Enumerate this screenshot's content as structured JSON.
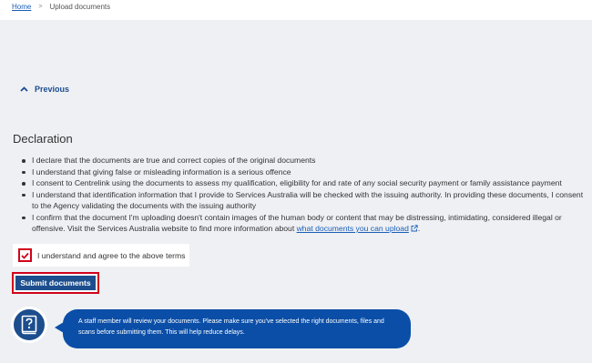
{
  "breadcrumb": {
    "home_label": "Home",
    "separator": ">",
    "current_label": "Upload documents"
  },
  "nav": {
    "previous_label": "Previous"
  },
  "declaration": {
    "title": "Declaration",
    "items": [
      "I declare that the documents are true and correct copies of the original documents",
      "I understand that giving false or misleading information is a serious offence",
      "I consent to Centrelink using the documents to assess my qualification, eligibility for and rate of any social security payment or family assistance payment",
      "I understand that identification information that I provide to Services Australia will be checked with the issuing authority. In providing these documents, I consent to the Agency validating the documents with the issuing authority"
    ],
    "last_item_text": "I confirm that the document I'm uploading doesn't contain images of the human body or content that may be distressing, intimidating, considered illegal or offensive. Visit the Services Australia website to find more information about ",
    "last_item_link": "what documents you can upload",
    "last_item_end": "."
  },
  "agree": {
    "label": "I understand and agree to the above terms",
    "checked": true
  },
  "submit": {
    "label": "Submit documents"
  },
  "help": {
    "icon": "question-book-icon",
    "message": "A staff member will review your documents. Please make sure you've selected the right documents, files and scans before submitting them. This will help reduce delays."
  },
  "colors": {
    "accent": "#1c4e8e",
    "link": "#1a5eb6",
    "focus": "#d0021b",
    "bubble": "#0a4ea7"
  }
}
